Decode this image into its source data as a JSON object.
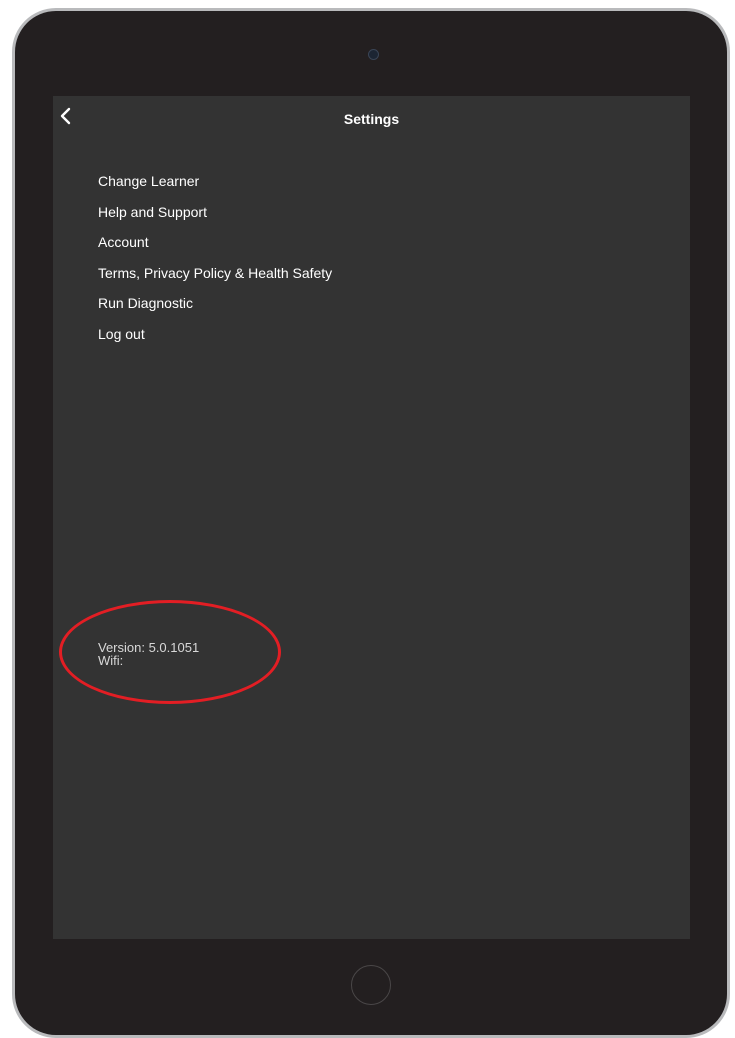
{
  "header": {
    "title": "Settings",
    "back_icon": "chevron-left-icon"
  },
  "menu": {
    "items": [
      {
        "label": "Change Learner"
      },
      {
        "label": "Help and Support"
      },
      {
        "label": "Account"
      },
      {
        "label": "Terms, Privacy Policy & Health Safety"
      },
      {
        "label": "Run Diagnostic"
      },
      {
        "label": "Log out"
      }
    ]
  },
  "footer": {
    "version": "Version: 5.0.1051",
    "wifi": "Wifi:"
  },
  "colors": {
    "screen_background": "#333333",
    "device_body": "#231f20",
    "annotation": "#e31e24"
  }
}
